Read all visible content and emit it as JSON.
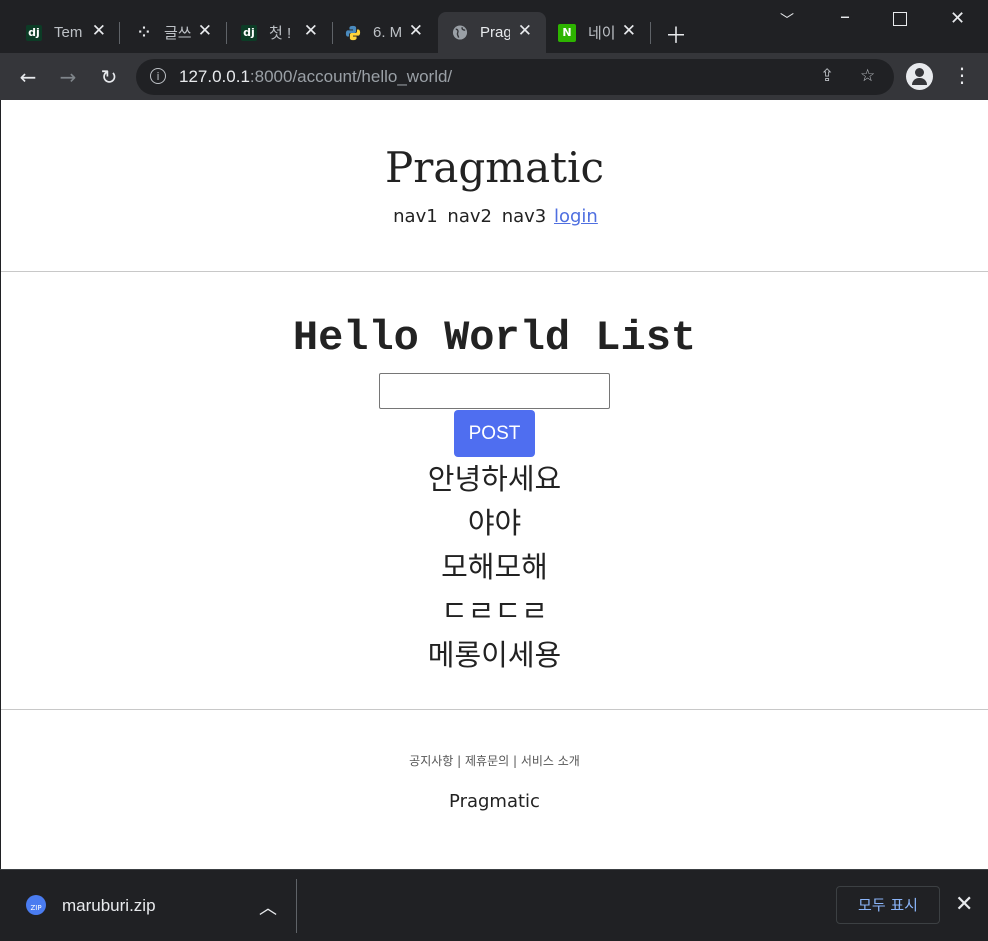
{
  "browser": {
    "tabs": [
      {
        "title": "Tem",
        "favicon": "django-icon"
      },
      {
        "title": "글쓰",
        "favicon": "tistory-icon"
      },
      {
        "title": "첫 !",
        "favicon": "django-icon"
      },
      {
        "title": "6. M",
        "favicon": "python-icon"
      },
      {
        "title": "Prag",
        "favicon": "globe-icon",
        "active": true
      },
      {
        "title": "네이",
        "favicon": "naver-icon"
      }
    ],
    "url_host": "127.0.0.1",
    "url_rest": ":8000/account/hello_world/"
  },
  "page": {
    "brand": "Pragmatic",
    "nav": [
      "nav1",
      "nav2",
      "nav3"
    ],
    "login_link": "login",
    "heading": "Hello World List",
    "input_value": "",
    "post_button": "POST",
    "items": [
      "안녕하세요",
      "야야",
      "모해모해",
      "ㄷㄹㄷㄹ",
      "메롱이세용"
    ],
    "footer_links": "공지사항 | 제휴문의 | 서비스 소개",
    "footer_brand": "Pragmatic"
  },
  "downloads": {
    "file_name": "maruburi.zip",
    "file_icon_label": "ZIP",
    "show_all": "모두 표시"
  },
  "colors": {
    "accent": "#4f6ef0",
    "link": "#4f6fe0",
    "chrome_dark": "#202124",
    "chrome_toolbar": "#35363a"
  }
}
